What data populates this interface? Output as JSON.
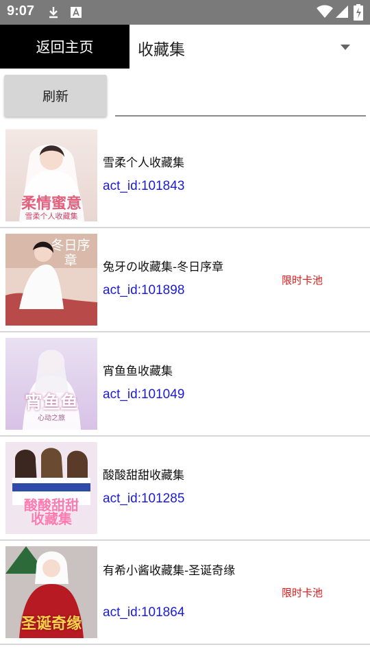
{
  "status_bar": {
    "time": "9:07"
  },
  "header": {
    "back_label": "返回主页",
    "collection_selected": "收藏集"
  },
  "toolbar": {
    "refresh_label": "刷新",
    "search_value": ""
  },
  "items": [
    {
      "title": "雪柔个人收藏集",
      "act_id": "act_id:101843",
      "badge": "",
      "thumb_caption": "柔情蜜意",
      "thumb_sub": "雪柔个人收藏集"
    },
    {
      "title": "兔牙の收藏集-冬日序章",
      "act_id": "act_id:101898",
      "badge": "限时卡池",
      "thumb_caption": "冬日序章",
      "thumb_sub": ""
    },
    {
      "title": "宵鱼鱼收藏集",
      "act_id": "act_id:101049",
      "badge": "",
      "thumb_caption": "宵鱼鱼",
      "thumb_sub": "心动之旅"
    },
    {
      "title": "酸酸甜甜收藏集",
      "act_id": "act_id:101285",
      "badge": "",
      "thumb_caption": "酸酸甜甜",
      "thumb_sub": "收藏集"
    },
    {
      "title": "有希小酱收藏集-圣诞奇缘",
      "act_id": "act_id:101864",
      "badge": "限时卡池",
      "thumb_caption": "圣诞奇缘",
      "thumb_sub": ""
    }
  ]
}
